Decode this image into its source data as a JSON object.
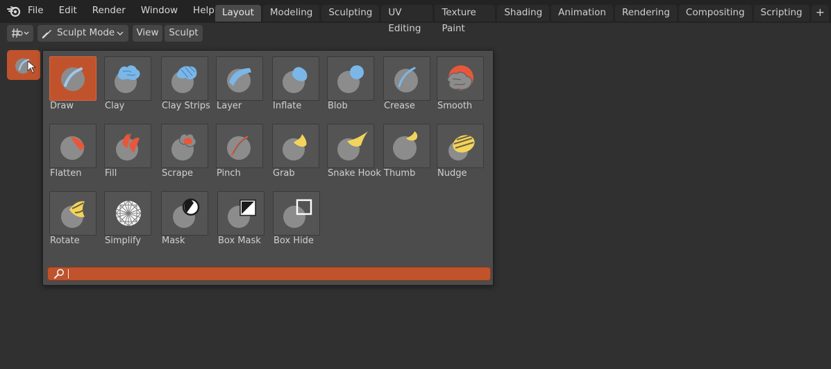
{
  "menu": [
    "File",
    "Edit",
    "Render",
    "Window",
    "Help"
  ],
  "workspace_tabs": [
    "Layout",
    "Modeling",
    "Sculpting",
    "UV Editing",
    "Texture Paint",
    "Shading",
    "Animation",
    "Rendering",
    "Compositing",
    "Scripting"
  ],
  "active_tab": "Layout",
  "add_tab_label": "+",
  "header": {
    "mode_label": "Sculpt Mode",
    "view_label": "View",
    "sculpt_label": "Sculpt"
  },
  "tools": [
    {
      "label": "Draw",
      "icon": "draw-brush-icon",
      "selected": true
    },
    {
      "label": "Clay",
      "icon": "clay-brush-icon"
    },
    {
      "label": "Clay Strips",
      "icon": "clay-strips-brush-icon"
    },
    {
      "label": "Layer",
      "icon": "layer-brush-icon"
    },
    {
      "label": "Inflate",
      "icon": "inflate-brush-icon"
    },
    {
      "label": "Blob",
      "icon": "blob-brush-icon"
    },
    {
      "label": "Crease",
      "icon": "crease-brush-icon"
    },
    {
      "label": "Smooth",
      "icon": "smooth-brush-icon"
    },
    {
      "label": "Flatten",
      "icon": "flatten-brush-icon"
    },
    {
      "label": "Fill",
      "icon": "fill-brush-icon"
    },
    {
      "label": "Scrape",
      "icon": "scrape-brush-icon"
    },
    {
      "label": "Pinch",
      "icon": "pinch-brush-icon"
    },
    {
      "label": "Grab",
      "icon": "grab-brush-icon"
    },
    {
      "label": "Snake Hook",
      "icon": "snake-hook-brush-icon"
    },
    {
      "label": "Thumb",
      "icon": "thumb-brush-icon"
    },
    {
      "label": "Nudge",
      "icon": "nudge-brush-icon"
    },
    {
      "label": "Rotate",
      "icon": "rotate-brush-icon"
    },
    {
      "label": "Simplify",
      "icon": "simplify-brush-icon"
    },
    {
      "label": "Mask",
      "icon": "mask-brush-icon"
    },
    {
      "label": "Box Mask",
      "icon": "box-mask-icon"
    },
    {
      "label": "Box Hide",
      "icon": "box-hide-icon"
    }
  ],
  "search": {
    "value": "",
    "placeholder": ""
  },
  "colors": {
    "accent": "#c0532c",
    "blue_brush": "#7ab7e8",
    "red_brush": "#e8573a",
    "yellow_brush": "#f2d45c",
    "sphere": "#8c8c8c"
  }
}
